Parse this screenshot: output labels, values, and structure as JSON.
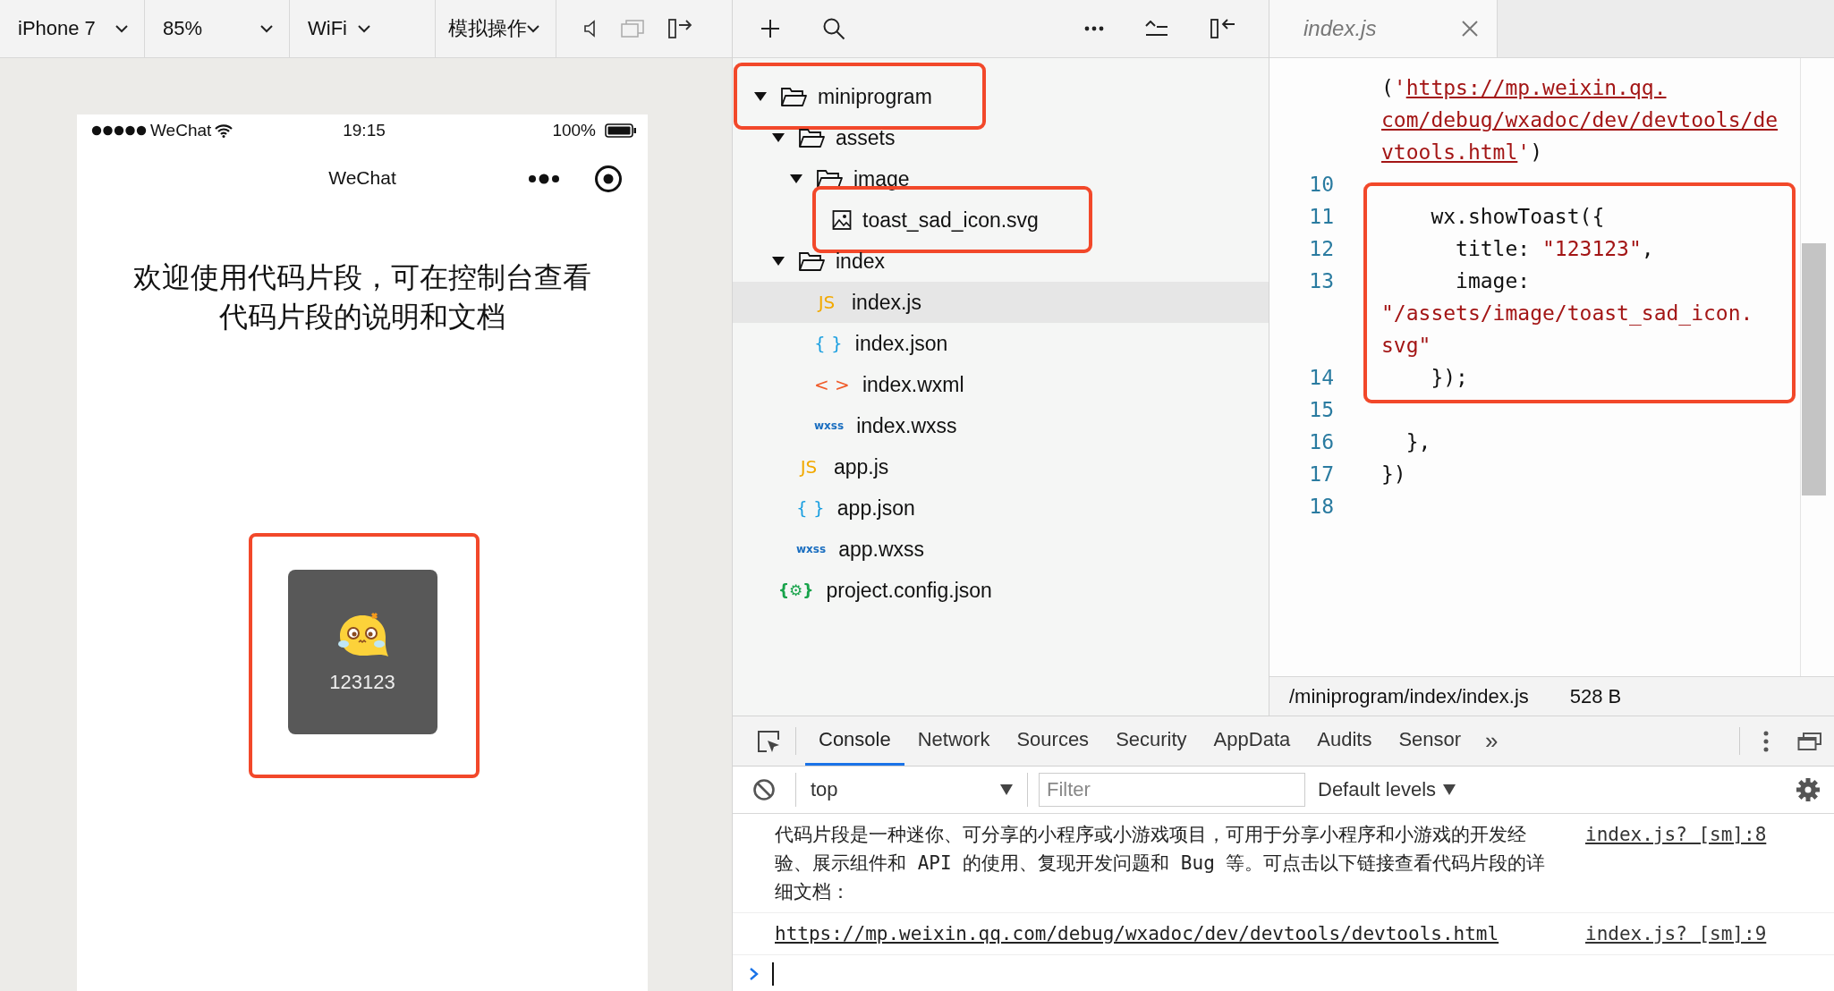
{
  "simulator_toolbar": {
    "dropdowns": [
      {
        "label": "iPhone 7"
      },
      {
        "label": "85%"
      },
      {
        "label": "WiFi"
      },
      {
        "label": "模拟操作"
      }
    ]
  },
  "phone": {
    "status_bar": {
      "carrier": "WeChat",
      "time": "19:15",
      "battery": "100%"
    },
    "nav_title": "WeChat",
    "message": "欢迎使用代码片段，可在控制台查看代码片段的说明和文档",
    "toast": {
      "title": "123123",
      "highlighted": true
    }
  },
  "file_tree": [
    {
      "name": "miniprogram",
      "kind": "folder",
      "expanded": true,
      "selected": false,
      "highlighted": true,
      "children": [
        {
          "name": "assets",
          "kind": "folder",
          "expanded": true,
          "selected": false,
          "highlighted": false,
          "children": [
            {
              "name": "image",
              "kind": "folder",
              "expanded": true,
              "selected": false,
              "highlighted": false,
              "children": [
                {
                  "name": "toast_sad_icon.svg",
                  "kind": "image",
                  "selected": false,
                  "highlighted": true
                }
              ]
            }
          ]
        },
        {
          "name": "index",
          "kind": "folder",
          "expanded": true,
          "selected": false,
          "highlighted": false,
          "children": [
            {
              "name": "index.js",
              "kind": "js",
              "icon_text": "JS",
              "selected": true,
              "highlighted": false
            },
            {
              "name": "index.json",
              "kind": "json",
              "icon_text": "{ }",
              "selected": false,
              "highlighted": false
            },
            {
              "name": "index.wxml",
              "kind": "wxml",
              "icon_text": "< >",
              "selected": false,
              "highlighted": false
            },
            {
              "name": "index.wxss",
              "kind": "wxss",
              "icon_text": "wxss",
              "selected": false,
              "highlighted": false
            }
          ]
        },
        {
          "name": "app.js",
          "kind": "js",
          "icon_text": "JS",
          "selected": false,
          "highlighted": false
        },
        {
          "name": "app.json",
          "kind": "json",
          "icon_text": "{ }",
          "selected": false,
          "highlighted": false
        },
        {
          "name": "app.wxss",
          "kind": "wxss",
          "icon_text": "wxss",
          "selected": false,
          "highlighted": false
        }
      ]
    },
    {
      "name": "project.config.json",
      "kind": "config",
      "icon_text": "{⚙}",
      "selected": false,
      "highlighted": false
    }
  ],
  "editor": {
    "tab": {
      "label": "index.js"
    },
    "lines": [
      {
        "highlighted": false,
        "tokens": [
          {
            "kind": "plain",
            "text": "("
          },
          {
            "kind": "string",
            "text": "'"
          },
          {
            "kind": "link",
            "text": "https://mp.weixin.qq."
          }
        ]
      },
      {
        "highlighted": false,
        "tokens": [
          {
            "kind": "link",
            "text": "com/debug/wxadoc/dev/devtools/de"
          }
        ]
      },
      {
        "highlighted": false,
        "tokens": [
          {
            "kind": "link",
            "text": "vtools.html"
          },
          {
            "kind": "string",
            "text": "'"
          },
          {
            "kind": "plain",
            "text": ")"
          }
        ]
      },
      {
        "number": "10",
        "highlighted": false
      },
      {
        "number": "11",
        "highlighted": true,
        "tokens": [
          {
            "kind": "plain",
            "text": "    wx.showToast({"
          }
        ]
      },
      {
        "number": "12",
        "highlighted": true,
        "tokens": [
          {
            "kind": "plain",
            "text": "      title: "
          },
          {
            "kind": "string",
            "text": "\"123123\""
          },
          {
            "kind": "plain",
            "text": ","
          }
        ]
      },
      {
        "number": "13",
        "highlighted": true,
        "tokens": [
          {
            "kind": "plain",
            "text": "      image:"
          }
        ]
      },
      {
        "highlighted": true,
        "tokens": [
          {
            "kind": "string",
            "text": "\"/assets/image/toast_sad_icon."
          }
        ]
      },
      {
        "highlighted": true,
        "tokens": [
          {
            "kind": "string",
            "text": "svg\""
          }
        ]
      },
      {
        "number": "14",
        "highlighted": true,
        "tokens": [
          {
            "kind": "plain",
            "text": "    });"
          }
        ]
      },
      {
        "number": "15",
        "highlighted": false
      },
      {
        "number": "16",
        "highlighted": false,
        "tokens": [
          {
            "kind": "plain",
            "text": "  },"
          }
        ]
      },
      {
        "number": "17",
        "highlighted": false,
        "tokens": [
          {
            "kind": "plain",
            "text": "})"
          }
        ]
      },
      {
        "number": "18",
        "highlighted": false
      }
    ],
    "status_bar": {
      "path": "/miniprogram/index/index.js",
      "size": "528 B"
    }
  },
  "devtools": {
    "tabs": [
      {
        "label": "Console",
        "selected": true
      },
      {
        "label": "Network",
        "selected": false
      },
      {
        "label": "Sources",
        "selected": false
      },
      {
        "label": "Security",
        "selected": false
      },
      {
        "label": "AppData",
        "selected": false
      },
      {
        "label": "Audits",
        "selected": false
      },
      {
        "label": "Sensor",
        "selected": false
      }
    ],
    "more_tabs": "»",
    "context": "top",
    "filter_placeholder": "Filter",
    "levels": "Default levels",
    "messages": [
      {
        "kind": "text",
        "text": "代码片段是一种迷你、可分享的小程序或小游戏项目，可用于分享小程序和小游戏的开发经验、展示组件和 API 的使用、复现开发问题和 Bug 等。可点击以下链接查看代码片段的详细文档：",
        "source": "index.js? [sm]:8"
      },
      {
        "kind": "link",
        "text": "https://mp.weixin.qq.com/debug/wxadoc/dev/devtools/devtools.html",
        "source": "index.js? [sm]:9"
      }
    ]
  }
}
